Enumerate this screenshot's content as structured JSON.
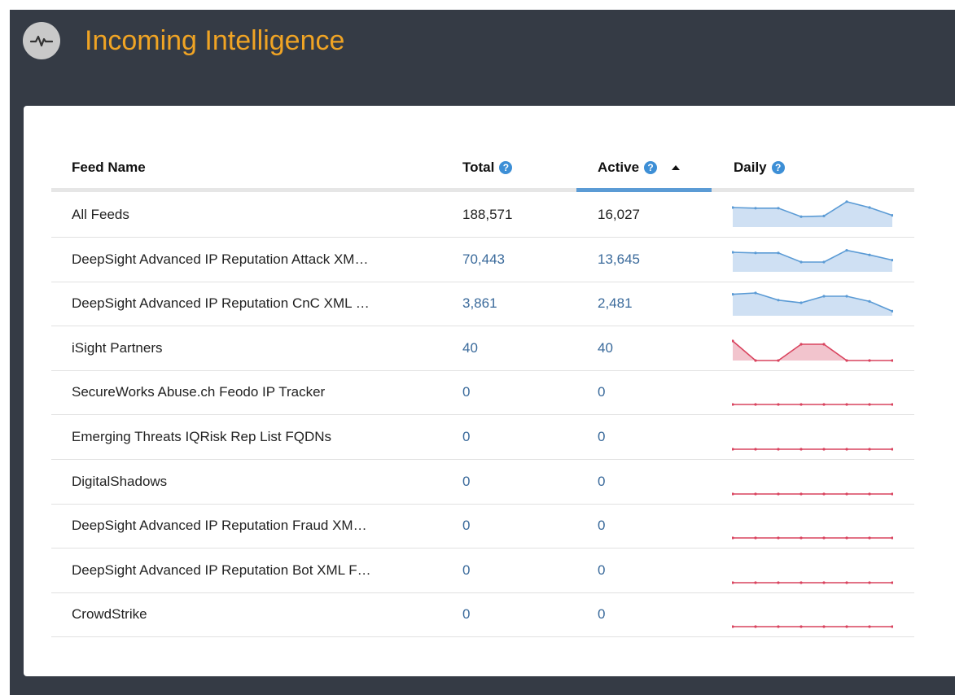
{
  "header": {
    "title": "Incoming Intelligence",
    "icon": "pulse-icon"
  },
  "table": {
    "columns": {
      "name": "Feed Name",
      "total": "Total",
      "active": "Active",
      "daily": "Daily",
      "help_glyph": "?"
    },
    "sort": {
      "column": "Active",
      "direction": "ascending"
    },
    "rows": [
      {
        "name": "All Feeds",
        "total": "188,571",
        "active": "16,027",
        "link": false,
        "spark": [
          30,
          29,
          29,
          16,
          17,
          39,
          30,
          18
        ],
        "spark_color": "blue"
      },
      {
        "name": "DeepSight Advanced IP Reputation Attack XM…",
        "total": "70,443",
        "active": "13,645",
        "link": true,
        "spark": [
          30,
          29,
          29,
          15,
          15,
          33,
          26,
          18
        ],
        "spark_color": "blue"
      },
      {
        "name": "DeepSight Advanced IP Reputation CnC XML …",
        "total": "3,861",
        "active": "2,481",
        "link": true,
        "spark": [
          33,
          35,
          24,
          20,
          30,
          30,
          22,
          7
        ],
        "spark_color": "blue"
      },
      {
        "name": "iSight Partners",
        "total": "40",
        "active": "40",
        "link": true,
        "spark": [
          30,
          0,
          0,
          25,
          25,
          0,
          0,
          0
        ],
        "spark_color": "red"
      },
      {
        "name": "SecureWorks Abuse.ch Feodo IP Tracker",
        "total": "0",
        "active": "0",
        "link": true,
        "spark": [
          0,
          0,
          0,
          0,
          0,
          0,
          0,
          0
        ],
        "spark_color": "red"
      },
      {
        "name": "Emerging Threats IQRisk Rep List FQDNs",
        "total": "0",
        "active": "0",
        "link": true,
        "spark": [
          0,
          0,
          0,
          0,
          0,
          0,
          0,
          0
        ],
        "spark_color": "red"
      },
      {
        "name": "DigitalShadows",
        "total": "0",
        "active": "0",
        "link": true,
        "spark": [
          0,
          0,
          0,
          0,
          0,
          0,
          0,
          0
        ],
        "spark_color": "red"
      },
      {
        "name": "DeepSight Advanced IP Reputation Fraud XM…",
        "total": "0",
        "active": "0",
        "link": true,
        "spark": [
          0,
          0,
          0,
          0,
          0,
          0,
          0,
          0
        ],
        "spark_color": "red"
      },
      {
        "name": "DeepSight Advanced IP Reputation Bot XML F…",
        "total": "0",
        "active": "0",
        "link": true,
        "spark": [
          0,
          0,
          0,
          0,
          0,
          0,
          0,
          0
        ],
        "spark_color": "red"
      },
      {
        "name": "CrowdStrike",
        "total": "0",
        "active": "0",
        "link": true,
        "spark": [
          0,
          0,
          0,
          0,
          0,
          0,
          0,
          0
        ],
        "spark_color": "red"
      }
    ]
  },
  "colors": {
    "accent": "#f0a424",
    "header_bg": "#353b45",
    "link": "#3a6a9b",
    "help": "#3d8fd6",
    "spark_blue_line": "#5b9bd5",
    "spark_blue_fill": "#cfe0f3",
    "spark_red_line": "#d9435e",
    "spark_red_fill": "#f2c4cd"
  }
}
